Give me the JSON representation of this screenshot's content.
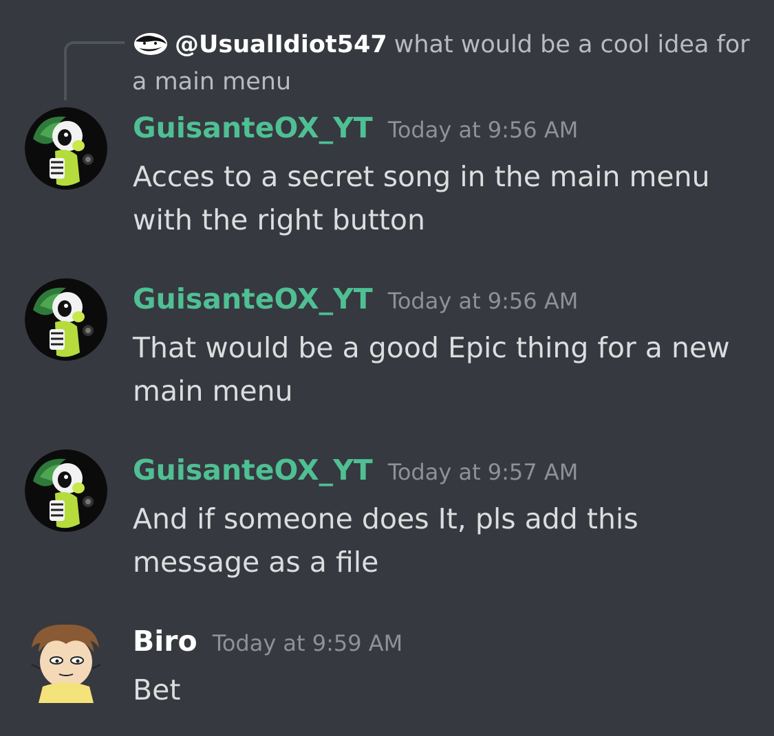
{
  "reply": {
    "author": "@UsualIdiot547",
    "text": "what would be a cool idea for a main menu"
  },
  "messages": [
    {
      "author": "GuisanteOX_YT",
      "timestamp": "Today at 9:56 AM",
      "content": "Acces to a secret song in the main menu with the right button",
      "author_color": "#4fbf94"
    },
    {
      "author": "GuisanteOX_YT",
      "timestamp": "Today at 9:56 AM",
      "content": "That would be a good Epic thing for a new main menu",
      "author_color": "#4fbf94"
    },
    {
      "author": "GuisanteOX_YT",
      "timestamp": "Today at 9:57 AM",
      "content": "And if someone does It, pls add this message as a file",
      "author_color": "#4fbf94"
    },
    {
      "author": "Biro",
      "timestamp": "Today at 9:59 AM",
      "content": "Bet",
      "author_color": "#ffffff"
    }
  ],
  "theme": {
    "background": "#36393f",
    "text": "#dcddde",
    "muted": "#8e9297"
  }
}
